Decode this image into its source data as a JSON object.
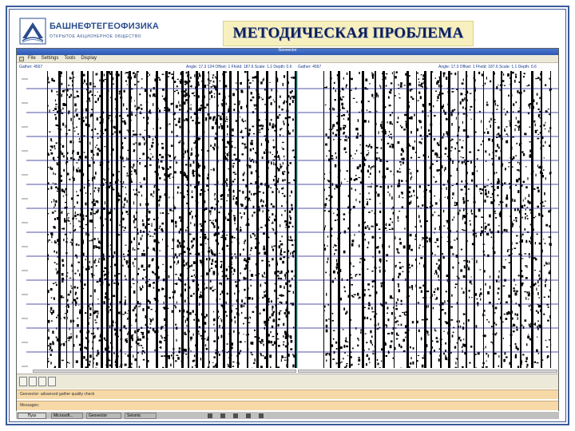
{
  "logo": {
    "name": "БАШНЕФТЕГЕОФИЗИКА",
    "subtitle": "ОТКРЫТОЕ АКЦИОНЕРНОЕ ОБЩЕСТВО"
  },
  "slide_title": "МЕТОДИЧЕСКАЯ ПРОБЛЕМА",
  "window": {
    "title": "Geovector",
    "menu": [
      "File",
      "Settings",
      "Tools",
      "Display"
    ],
    "left_panel": {
      "label": "Gather: 4567",
      "info": "Angle: 17.3 124 Offset: 1 Fhold: 187.6 Scale: 1.1 Depth: 0.6"
    },
    "right_panel": {
      "label": "Gather: 4567",
      "info": "Angle: 17.3 Offset: 1 Fhold: 187.6 Scale: 1.1 Depth: 0.6"
    },
    "status_lines": [
      "Geovector: advanced gather quality check",
      "Messages:"
    ]
  },
  "taskbar": {
    "start_label": "Пуск",
    "tasks": [
      "Microsoft...",
      "Geovector",
      "Seismic"
    ]
  },
  "colors": {
    "frame": "#3a5a9a",
    "title_bg": "#f7f0be",
    "title_text": "#0d1f57",
    "trace_color": "#000000",
    "grid_color": "#1a1a8a",
    "divider_color": "#3cc8c8",
    "status_bg": "#f7d9a8"
  }
}
